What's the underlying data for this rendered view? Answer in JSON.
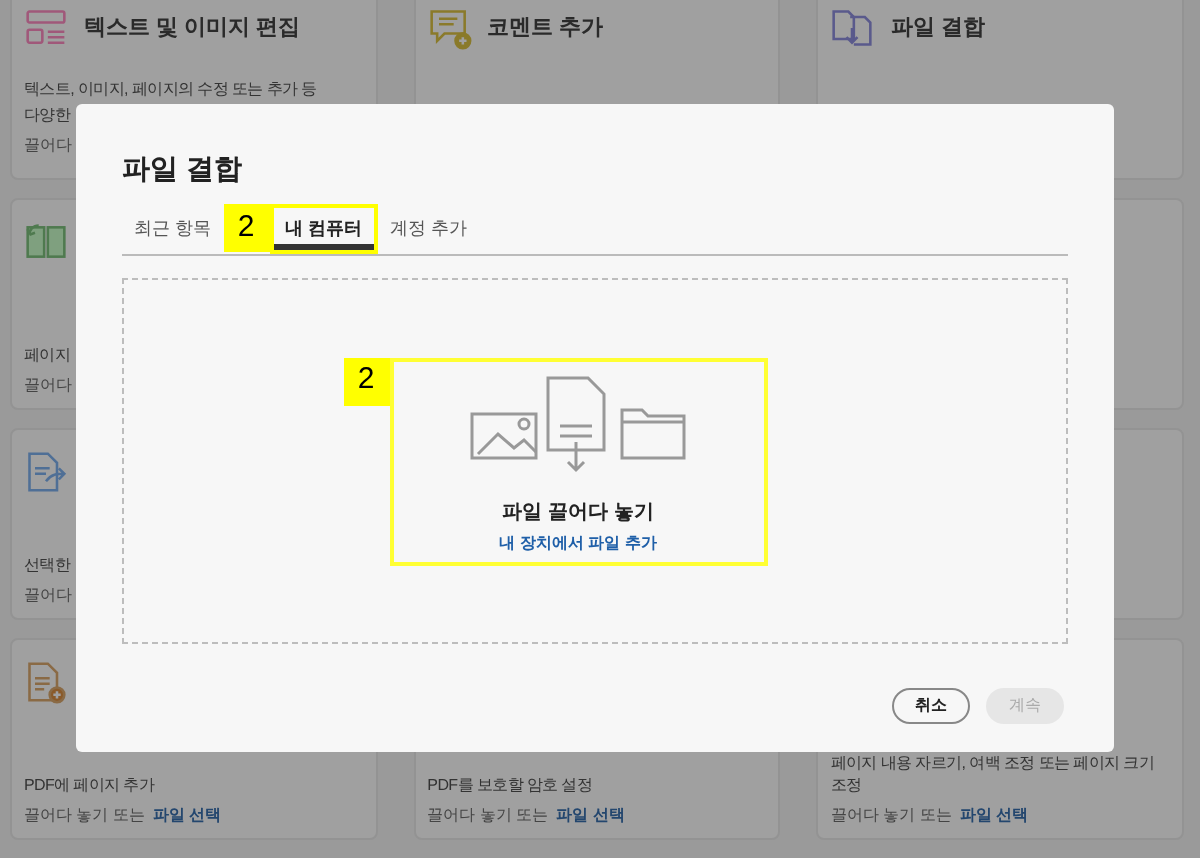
{
  "card_grid": [
    [
      {
        "kind": "layout",
        "title": "텍스트 및 이미지 편집",
        "description": [
          "텍스트, 이미지, 페이지의 수정 또는 추가 등",
          "다양한"
        ],
        "hint": "끌어다"
      },
      {
        "kind": "comment",
        "title": "코멘트 추가"
      },
      {
        "kind": "combine",
        "title": "파일 결합"
      }
    ],
    [
      {
        "kind": "pages",
        "description": [
          "페이지"
        ],
        "hint": "끌어다"
      }
    ],
    [
      {
        "kind": "export",
        "description": [
          "선택한"
        ],
        "hint": "끌어다"
      }
    ],
    [
      {
        "kind": "add-page",
        "description": [
          "PDF에 페이지 추가"
        ],
        "hint": "끌어다 놓기 또는",
        "link": "파일 선택"
      },
      {
        "kind": "plain",
        "description": [
          "PDF를 보호할 암호 설정"
        ],
        "hint": "끌어다 놓기 또는",
        "link": "파일 선택"
      },
      {
        "kind": "plain",
        "description": [
          "페이지 내용 자르기, 여백 조정 또는 페이지 크기 조정"
        ],
        "hint": "끌어다 놓기 또는",
        "link": "파일 선택"
      }
    ]
  ],
  "dialog": {
    "title": "파일 결합",
    "tabs": [
      {
        "label": "최근 항목",
        "selected": false
      },
      {
        "label": "내 컴퓨터",
        "selected": true,
        "annotation": "2"
      },
      {
        "label": "계정 추가",
        "selected": false
      }
    ],
    "drop_zone": {
      "annotation": "2",
      "title": "파일 끌어다 놓기",
      "link": "내 장치에서 파일 추가"
    },
    "buttons": [
      {
        "label": "취소",
        "disabled": false
      },
      {
        "label": "계속",
        "disabled": true
      }
    ]
  }
}
